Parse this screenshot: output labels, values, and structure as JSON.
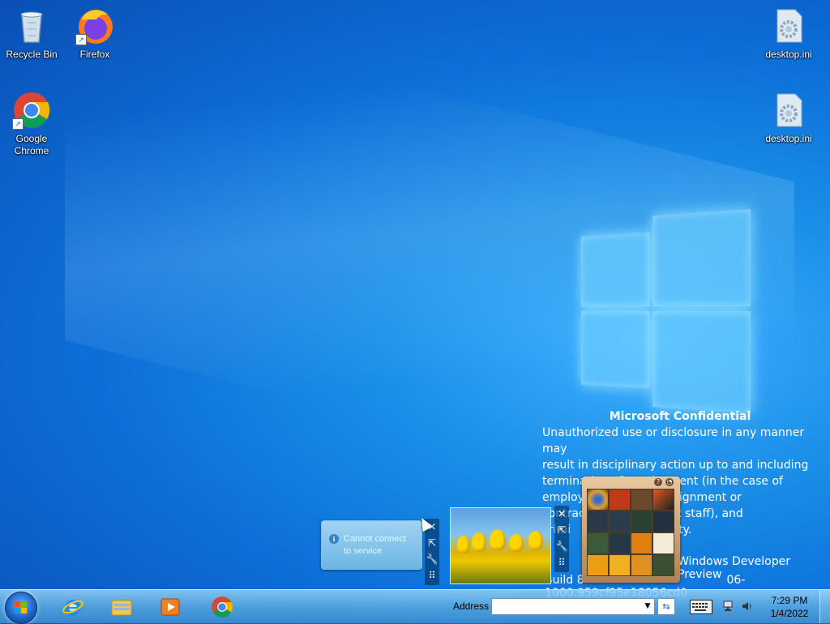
{
  "desktop_icons": [
    {
      "label": "Recycle Bin",
      "icon": "recycle-bin-icon"
    },
    {
      "label": "Firefox",
      "icon": "firefox-icon"
    },
    {
      "label": "Google Chrome",
      "icon": "chrome-icon"
    },
    {
      "label": "desktop.ini",
      "icon": "settings-file-icon"
    },
    {
      "label": "desktop.ini",
      "icon": "settings-file-icon"
    }
  ],
  "watermark": {
    "title": "Microsoft Confidential",
    "line1": "Unauthorized use or disclosure in any manner may",
    "line2": "result in disciplinary action up to and including",
    "line3": "termination of employment (in the case of",
    "line4_a": "employ",
    "line4_b": "of an assignment or",
    "line5_a": "contrac",
    "line5_b": "ntingent staff), and",
    "line6_a": "crimi",
    "line6_b": "l liability.",
    "edition": "Windows Developer Preview",
    "build_a": "Build 8",
    "build_b": "06-1000.959cf95e18056cd0"
  },
  "gadget_message": {
    "text_line1": "Cannot connect",
    "text_line2": "to service"
  },
  "gadget_controls": {
    "close": "✕",
    "size": "⇱",
    "options": "🔧",
    "drag": "⠿"
  },
  "puzzle": {
    "help": "?",
    "toggle": "◔"
  },
  "taskbar": {
    "address_label": "Address",
    "address_value": "",
    "pinned": [
      "internet-explorer-icon",
      "file-explorer-icon",
      "media-player-icon",
      "chrome-icon"
    ],
    "time": "7:29 PM",
    "date": "1/4/2022"
  },
  "colors": {
    "taskbar": "#5aaae1",
    "desktop": "#0c6fd8"
  }
}
